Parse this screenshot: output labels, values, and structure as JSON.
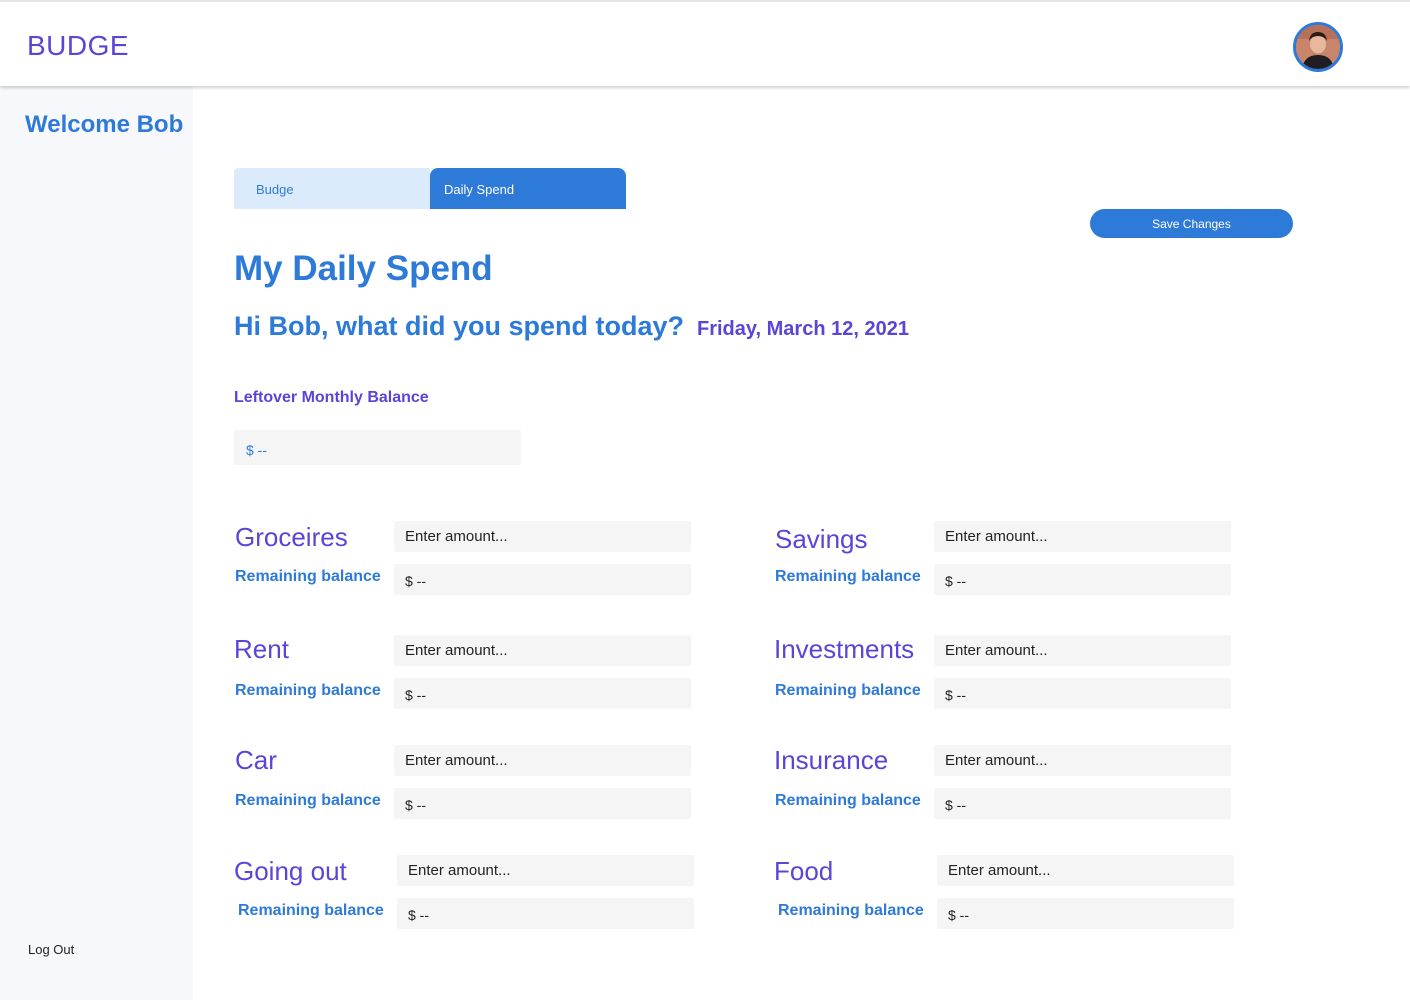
{
  "app": {
    "brand": "BUDGE"
  },
  "sidebar": {
    "welcome": "Welcome Bob",
    "logout": "Log Out"
  },
  "tabs": [
    {
      "label": "Budge",
      "active": false
    },
    {
      "label": "Daily Spend",
      "active": true
    }
  ],
  "toolbar": {
    "save_label": "Save Changes"
  },
  "main": {
    "title": "My Daily Spend",
    "greeting": "Hi Bob, what did you spend today?",
    "date": "Friday, March 12, 2021",
    "leftover_label": "Leftover Monthly Balance",
    "leftover_value": "$ --"
  },
  "categories": [
    {
      "name": "Groceires",
      "placeholder": "Enter amount...",
      "remaining_label": "Remaining balance",
      "remaining_value": "$ --"
    },
    {
      "name": "Savings",
      "placeholder": "Enter amount...",
      "remaining_label": "Remaining balance",
      "remaining_value": "$ --"
    },
    {
      "name": "Rent",
      "placeholder": "Enter amount...",
      "remaining_label": "Remaining balance",
      "remaining_value": "$ --"
    },
    {
      "name": "Investments",
      "placeholder": "Enter amount...",
      "remaining_label": "Remaining balance",
      "remaining_value": "$ --"
    },
    {
      "name": "Car",
      "placeholder": "Enter amount...",
      "remaining_label": "Remaining balance",
      "remaining_value": "$ --"
    },
    {
      "name": "Insurance",
      "placeholder": "Enter amount...",
      "remaining_label": "Remaining balance",
      "remaining_value": "$ --"
    },
    {
      "name": "Going out",
      "placeholder": "Enter amount...",
      "remaining_label": "Remaining balance",
      "remaining_value": "$ --"
    },
    {
      "name": "Food",
      "placeholder": "Enter amount...",
      "remaining_label": "Remaining balance",
      "remaining_value": "$ --"
    }
  ],
  "colors": {
    "accent": "#2e7ad8",
    "brand": "#5a45d6",
    "field_bg": "#f5f5f5",
    "sidebar_bg": "#f7f8fc"
  }
}
